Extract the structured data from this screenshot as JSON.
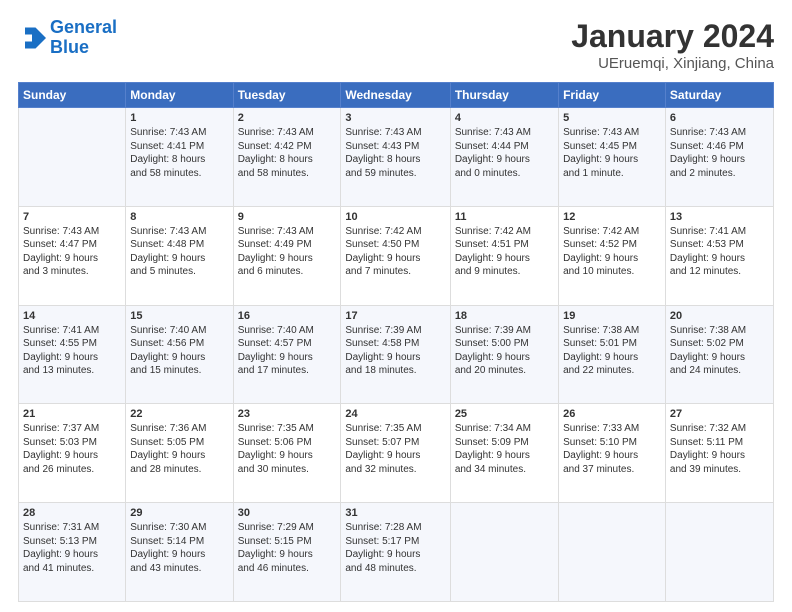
{
  "header": {
    "logo_line1": "General",
    "logo_line2": "Blue",
    "title": "January 2024",
    "subtitle": "UEruemqi, Xinjiang, China"
  },
  "days_of_week": [
    "Sunday",
    "Monday",
    "Tuesday",
    "Wednesday",
    "Thursday",
    "Friday",
    "Saturday"
  ],
  "weeks": [
    [
      {
        "num": "",
        "text": ""
      },
      {
        "num": "1",
        "text": "Sunrise: 7:43 AM\nSunset: 4:41 PM\nDaylight: 8 hours\nand 58 minutes."
      },
      {
        "num": "2",
        "text": "Sunrise: 7:43 AM\nSunset: 4:42 PM\nDaylight: 8 hours\nand 58 minutes."
      },
      {
        "num": "3",
        "text": "Sunrise: 7:43 AM\nSunset: 4:43 PM\nDaylight: 8 hours\nand 59 minutes."
      },
      {
        "num": "4",
        "text": "Sunrise: 7:43 AM\nSunset: 4:44 PM\nDaylight: 9 hours\nand 0 minutes."
      },
      {
        "num": "5",
        "text": "Sunrise: 7:43 AM\nSunset: 4:45 PM\nDaylight: 9 hours\nand 1 minute."
      },
      {
        "num": "6",
        "text": "Sunrise: 7:43 AM\nSunset: 4:46 PM\nDaylight: 9 hours\nand 2 minutes."
      }
    ],
    [
      {
        "num": "7",
        "text": "Sunrise: 7:43 AM\nSunset: 4:47 PM\nDaylight: 9 hours\nand 3 minutes."
      },
      {
        "num": "8",
        "text": "Sunrise: 7:43 AM\nSunset: 4:48 PM\nDaylight: 9 hours\nand 5 minutes."
      },
      {
        "num": "9",
        "text": "Sunrise: 7:43 AM\nSunset: 4:49 PM\nDaylight: 9 hours\nand 6 minutes."
      },
      {
        "num": "10",
        "text": "Sunrise: 7:42 AM\nSunset: 4:50 PM\nDaylight: 9 hours\nand 7 minutes."
      },
      {
        "num": "11",
        "text": "Sunrise: 7:42 AM\nSunset: 4:51 PM\nDaylight: 9 hours\nand 9 minutes."
      },
      {
        "num": "12",
        "text": "Sunrise: 7:42 AM\nSunset: 4:52 PM\nDaylight: 9 hours\nand 10 minutes."
      },
      {
        "num": "13",
        "text": "Sunrise: 7:41 AM\nSunset: 4:53 PM\nDaylight: 9 hours\nand 12 minutes."
      }
    ],
    [
      {
        "num": "14",
        "text": "Sunrise: 7:41 AM\nSunset: 4:55 PM\nDaylight: 9 hours\nand 13 minutes."
      },
      {
        "num": "15",
        "text": "Sunrise: 7:40 AM\nSunset: 4:56 PM\nDaylight: 9 hours\nand 15 minutes."
      },
      {
        "num": "16",
        "text": "Sunrise: 7:40 AM\nSunset: 4:57 PM\nDaylight: 9 hours\nand 17 minutes."
      },
      {
        "num": "17",
        "text": "Sunrise: 7:39 AM\nSunset: 4:58 PM\nDaylight: 9 hours\nand 18 minutes."
      },
      {
        "num": "18",
        "text": "Sunrise: 7:39 AM\nSunset: 5:00 PM\nDaylight: 9 hours\nand 20 minutes."
      },
      {
        "num": "19",
        "text": "Sunrise: 7:38 AM\nSunset: 5:01 PM\nDaylight: 9 hours\nand 22 minutes."
      },
      {
        "num": "20",
        "text": "Sunrise: 7:38 AM\nSunset: 5:02 PM\nDaylight: 9 hours\nand 24 minutes."
      }
    ],
    [
      {
        "num": "21",
        "text": "Sunrise: 7:37 AM\nSunset: 5:03 PM\nDaylight: 9 hours\nand 26 minutes."
      },
      {
        "num": "22",
        "text": "Sunrise: 7:36 AM\nSunset: 5:05 PM\nDaylight: 9 hours\nand 28 minutes."
      },
      {
        "num": "23",
        "text": "Sunrise: 7:35 AM\nSunset: 5:06 PM\nDaylight: 9 hours\nand 30 minutes."
      },
      {
        "num": "24",
        "text": "Sunrise: 7:35 AM\nSunset: 5:07 PM\nDaylight: 9 hours\nand 32 minutes."
      },
      {
        "num": "25",
        "text": "Sunrise: 7:34 AM\nSunset: 5:09 PM\nDaylight: 9 hours\nand 34 minutes."
      },
      {
        "num": "26",
        "text": "Sunrise: 7:33 AM\nSunset: 5:10 PM\nDaylight: 9 hours\nand 37 minutes."
      },
      {
        "num": "27",
        "text": "Sunrise: 7:32 AM\nSunset: 5:11 PM\nDaylight: 9 hours\nand 39 minutes."
      }
    ],
    [
      {
        "num": "28",
        "text": "Sunrise: 7:31 AM\nSunset: 5:13 PM\nDaylight: 9 hours\nand 41 minutes."
      },
      {
        "num": "29",
        "text": "Sunrise: 7:30 AM\nSunset: 5:14 PM\nDaylight: 9 hours\nand 43 minutes."
      },
      {
        "num": "30",
        "text": "Sunrise: 7:29 AM\nSunset: 5:15 PM\nDaylight: 9 hours\nand 46 minutes."
      },
      {
        "num": "31",
        "text": "Sunrise: 7:28 AM\nSunset: 5:17 PM\nDaylight: 9 hours\nand 48 minutes."
      },
      {
        "num": "",
        "text": ""
      },
      {
        "num": "",
        "text": ""
      },
      {
        "num": "",
        "text": ""
      }
    ]
  ]
}
